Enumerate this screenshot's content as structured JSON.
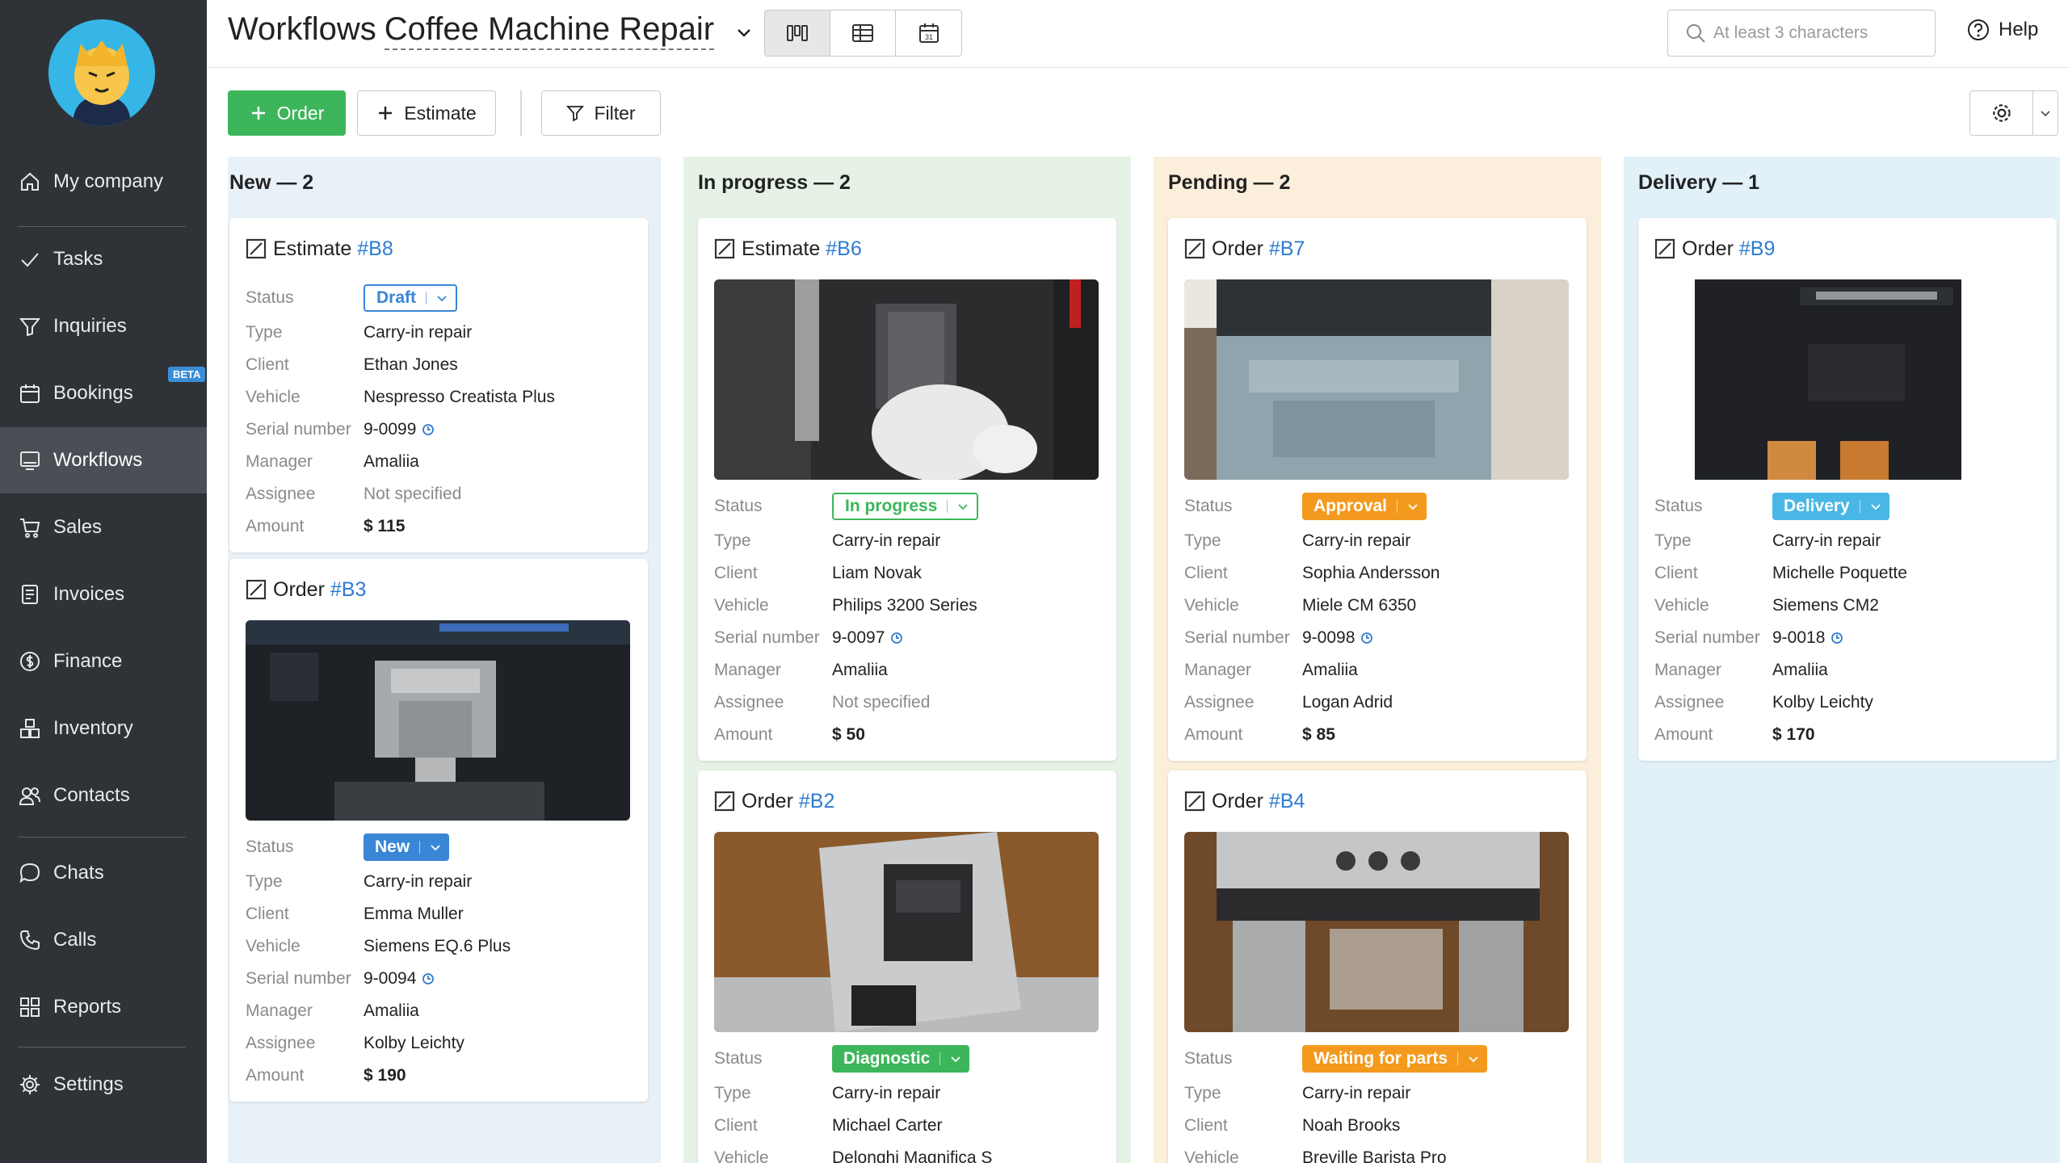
{
  "colors": {
    "accent_green": "#3db55b",
    "link_blue": "#2f7bd0",
    "sidebar_bg": "#2f3338"
  },
  "sidebar": {
    "items": [
      {
        "label": "My company",
        "icon": "home-icon"
      },
      {
        "label": "Tasks",
        "icon": "check-icon"
      },
      {
        "label": "Inquiries",
        "icon": "funnel-icon"
      },
      {
        "label": "Bookings",
        "icon": "calendar-icon",
        "badge": "BETA"
      },
      {
        "label": "Workflows",
        "icon": "monitor-icon",
        "active": true
      },
      {
        "label": "Sales",
        "icon": "cart-icon"
      },
      {
        "label": "Invoices",
        "icon": "document-icon"
      },
      {
        "label": "Finance",
        "icon": "dollar-icon"
      },
      {
        "label": "Inventory",
        "icon": "boxes-icon"
      },
      {
        "label": "Contacts",
        "icon": "people-icon"
      },
      {
        "label": "Chats",
        "icon": "chat-icon"
      },
      {
        "label": "Calls",
        "icon": "phone-icon"
      },
      {
        "label": "Reports",
        "icon": "reports-icon"
      },
      {
        "label": "Settings",
        "icon": "gear-icon"
      }
    ]
  },
  "header": {
    "title": "Workflows",
    "subtitle": "Coffee Machine Repair",
    "search_placeholder": "At least 3 characters",
    "help_label": "Help"
  },
  "toolbar": {
    "order_label": "Order",
    "estimate_label": "Estimate",
    "filter_label": "Filter"
  },
  "labels": {
    "status": "Status",
    "type": "Type",
    "client": "Client",
    "vehicle": "Vehicle",
    "serial": "Serial number",
    "manager": "Manager",
    "assignee": "Assignee",
    "amount": "Amount"
  },
  "columns": [
    {
      "title": "New — 2",
      "cards": [
        {
          "kind": "Estimate",
          "number": "#B8",
          "status": "Draft",
          "type": "Carry-in repair",
          "client": "Ethan Jones",
          "vehicle": "Nespresso Creatista Plus",
          "serial": "9-0099",
          "manager": "Amaliia",
          "assignee": "Not specified",
          "amount": "$ 115"
        },
        {
          "kind": "Order",
          "number": "#B3",
          "status": "New",
          "type": "Carry-in repair",
          "client": "Emma Muller",
          "vehicle": "Siemens EQ.6 Plus",
          "serial": "9-0094",
          "manager": "Amaliia",
          "assignee": "Kolby Leichty",
          "amount": "$ 190"
        }
      ]
    },
    {
      "title": "In progress — 2",
      "cards": [
        {
          "kind": "Estimate",
          "number": "#B6",
          "status": "In progress",
          "type": "Carry-in repair",
          "client": "Liam Novak",
          "vehicle": "Philips 3200 Series",
          "serial": "9-0097",
          "manager": "Amaliia",
          "assignee": "Not specified",
          "amount": "$ 50"
        },
        {
          "kind": "Order",
          "number": "#B2",
          "status": "Diagnostic",
          "type": "Carry-in repair",
          "client": "Michael Carter",
          "vehicle": "Delonghi Magnifica S"
        }
      ]
    },
    {
      "title": "Pending — 2",
      "cards": [
        {
          "kind": "Order",
          "number": "#B7",
          "status": "Approval",
          "type": "Carry-in repair",
          "client": "Sophia Andersson",
          "vehicle": "Miele CM 6350",
          "serial": "9-0098",
          "manager": "Amaliia",
          "assignee": "Logan Adrid",
          "amount": "$ 85"
        },
        {
          "kind": "Order",
          "number": "#B4",
          "status": "Waiting for parts",
          "type": "Carry-in repair",
          "client": "Noah Brooks",
          "vehicle": "Breville Barista Pro"
        }
      ]
    },
    {
      "title": "Delivery — 1",
      "cards": [
        {
          "kind": "Order",
          "number": "#B9",
          "status": "Delivery",
          "type": "Carry-in repair",
          "client": "Michelle Poquette",
          "vehicle": "Siemens CM2",
          "serial": "9-0018",
          "manager": "Amaliia",
          "assignee": "Kolby Leichty",
          "amount": "$ 170"
        }
      ]
    }
  ]
}
